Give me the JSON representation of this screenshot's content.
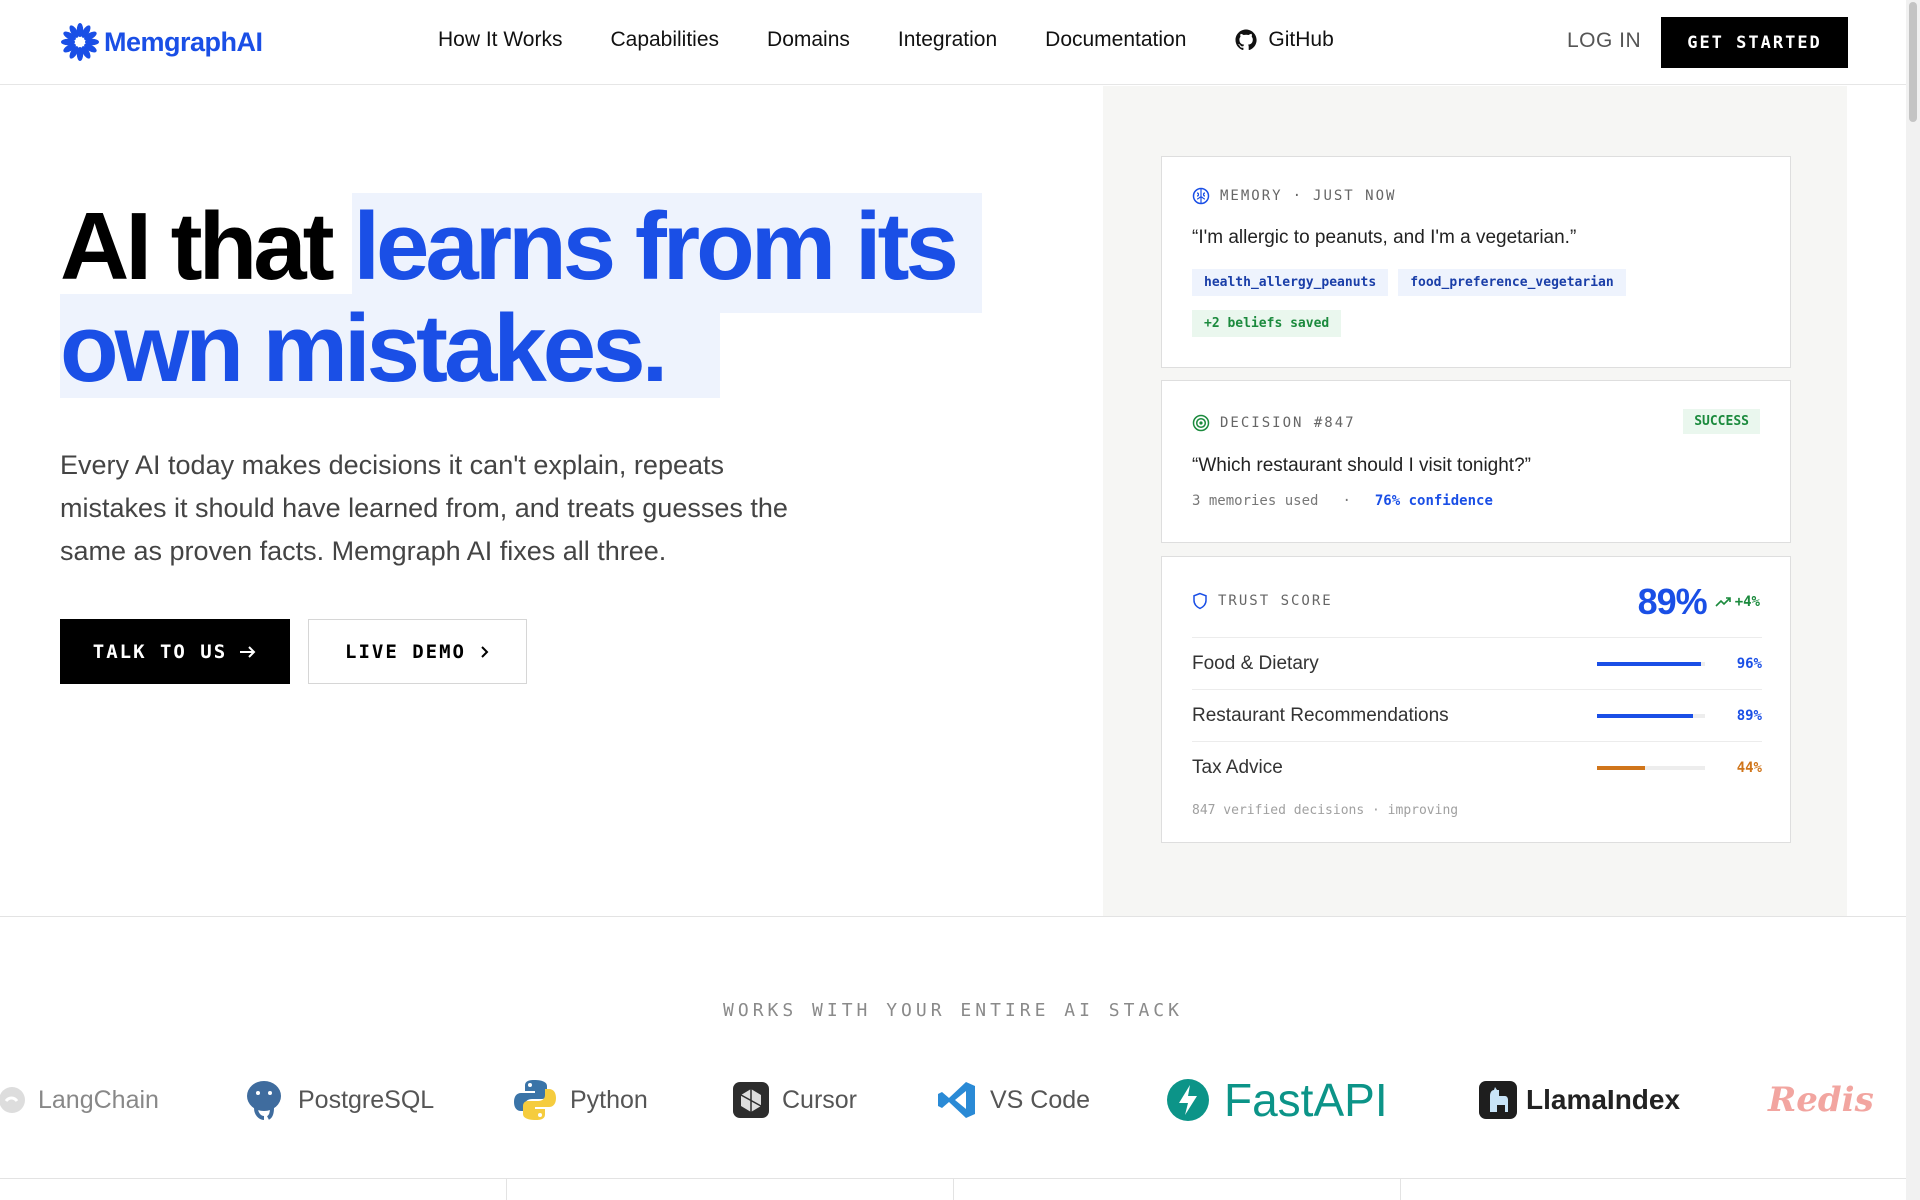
{
  "nav": {
    "brand": "MemgraphAI",
    "links": [
      "How It Works",
      "Capabilities",
      "Domains",
      "Integration",
      "Documentation"
    ],
    "github": "GitHub",
    "login": "LOG IN",
    "get_started": "GET STARTED"
  },
  "hero": {
    "title_part1": "AI that ",
    "title_part2": "learns from its",
    "title_part3": "own mistakes.",
    "description": "Every AI today makes decisions it can't explain, repeats mistakes it should have learned from, and treats guesses the same as proven facts. Memgraph AI fixes all three.",
    "btn_talk": "TALK TO US",
    "btn_demo": "LIVE DEMO"
  },
  "memory_card": {
    "label": "MEMORY",
    "time": "JUST NOW",
    "quote": "“I'm allergic to peanuts, and I'm a vegetarian.”",
    "tags": [
      "health_allergy_peanuts",
      "food_preference_vegetarian"
    ],
    "saved": "+2 beliefs saved"
  },
  "decision_card": {
    "label": "DECISION #847",
    "status": "SUCCESS",
    "quote": "“Which restaurant should I visit tonight?”",
    "memories": "3 memories used",
    "confidence": "76% confidence"
  },
  "trust_card": {
    "label": "TRUST SCORE",
    "score": "89%",
    "delta": "+4%",
    "rows": [
      {
        "label": "Food & Dietary",
        "pct": "96%",
        "value": 0.96,
        "color": "#1a4fe6"
      },
      {
        "label": "Restaurant Recommendations",
        "pct": "89%",
        "value": 0.89,
        "color": "#1a4fe6"
      },
      {
        "label": "Tax Advice",
        "pct": "44%",
        "value": 0.44,
        "color": "#d0751a"
      }
    ],
    "footer": "847 verified decisions · improving"
  },
  "stack": {
    "title": "WORKS WITH YOUR ENTIRE AI STACK",
    "logos": [
      "LangChain",
      "PostgreSQL",
      "Python",
      "Cursor",
      "VS Code",
      "FastAPI",
      "LlamaIndex",
      "Redis"
    ]
  },
  "colors": {
    "accent": "#1a4fe6",
    "success": "#1b8a3d",
    "warning": "#d0751a"
  }
}
